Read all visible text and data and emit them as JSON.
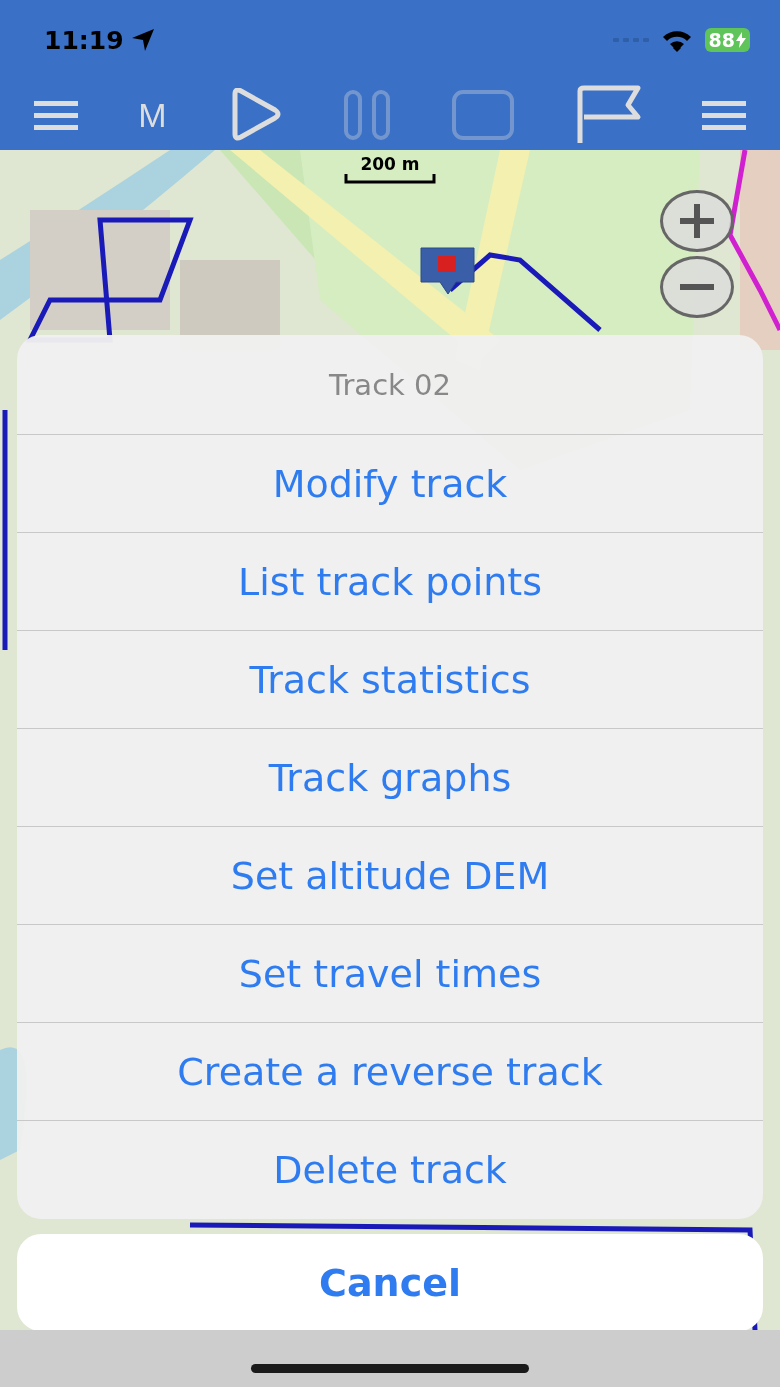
{
  "status_bar": {
    "time": "11:19",
    "battery": "88"
  },
  "toolbar": {
    "mode_label": "M",
    "buttons": [
      {
        "kind": "play",
        "disabled": false
      },
      {
        "kind": "pause",
        "disabled": true
      },
      {
        "kind": "stop",
        "disabled": true
      },
      {
        "kind": "flag",
        "disabled": false
      }
    ]
  },
  "map": {
    "kind": "picture",
    "scale": "200 m"
  },
  "action_sheet": {
    "title": "Track 02",
    "actions": [
      "Modify track",
      "List track points",
      "Track statistics",
      "Track graphs",
      "Set altitude DEM",
      "Set travel times",
      "Create a reverse track",
      "Delete track"
    ],
    "cancel": "Cancel"
  }
}
